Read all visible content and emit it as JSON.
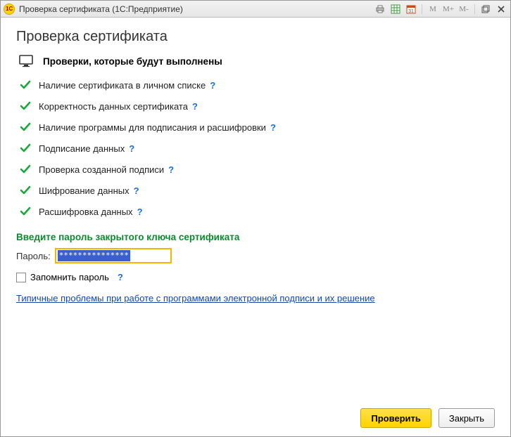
{
  "titlebar": {
    "text": "Проверка сертификата  (1С:Предприятие)",
    "buttons": {
      "m": "M",
      "mplus": "M+",
      "mminus": "M-"
    }
  },
  "page": {
    "title": "Проверка сертификата",
    "checks_header": "Проверки, которые будут выполнены",
    "help": "?"
  },
  "checks": [
    {
      "label": "Наличие сертификата в личном списке"
    },
    {
      "label": "Корректность данных сертификата"
    },
    {
      "label": "Наличие программы для подписания и расшифровки"
    },
    {
      "label": "Подписание данных"
    },
    {
      "label": "Проверка созданной подписи"
    },
    {
      "label": "Шифрование данных"
    },
    {
      "label": "Расшифровка данных"
    }
  ],
  "password": {
    "prompt": "Введите пароль закрытого ключа сертификата",
    "label": "Пароль:",
    "value": "***************",
    "remember": "Запомнить пароль"
  },
  "link": "Типичные проблемы при работе с программами электронной подписи и их решение",
  "footer": {
    "check": "Проверить",
    "close": "Закрыть"
  }
}
